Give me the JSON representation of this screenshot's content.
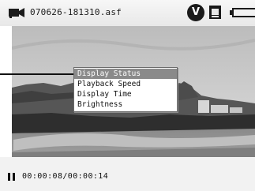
{
  "header": {
    "file_name": "070626-181310.asf",
    "status_badge": "V",
    "icons": [
      "camera-icon",
      "v-badge-icon",
      "display-mode-icon",
      "battery-icon"
    ]
  },
  "menu": {
    "items": [
      {
        "label": "Display Status",
        "selected": true
      },
      {
        "label": "Playback Speed",
        "selected": false
      },
      {
        "label": "Display Time",
        "selected": false
      },
      {
        "label": "Brightness",
        "selected": false
      }
    ]
  },
  "playback": {
    "state": "paused",
    "time_readout": "00:00:08/00:00:14"
  },
  "colors": {
    "menu_highlight": "#8a8a8a",
    "menu_border": "#6b6b6b",
    "bar_background": "#f2f2f2"
  }
}
